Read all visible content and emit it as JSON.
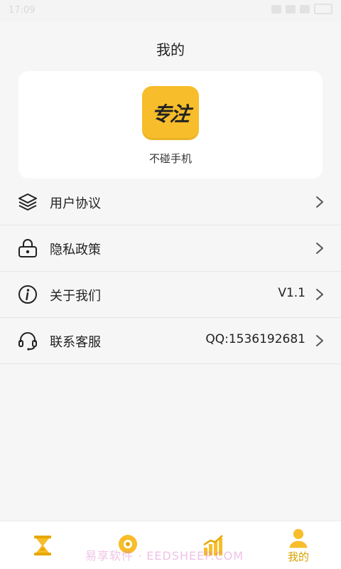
{
  "status_bar": {
    "time": "17:09"
  },
  "page": {
    "title": "我的"
  },
  "profile": {
    "logo_text": "专注",
    "app_name": "不碰手机"
  },
  "menu": [
    {
      "label": "用户协议",
      "value": "",
      "icon": "layers-icon"
    },
    {
      "label": "隐私政策",
      "value": "",
      "icon": "lock-icon"
    },
    {
      "label": "关于我们",
      "value": "V1.1",
      "icon": "info-icon"
    },
    {
      "label": "联系客服",
      "value": "QQ:1536192681",
      "icon": "headset-icon"
    }
  ],
  "tabs": [
    {
      "label": "",
      "icon": "hourglass-icon"
    },
    {
      "label": "",
      "icon": "focus-target-icon"
    },
    {
      "label": "",
      "icon": "chart-icon"
    },
    {
      "label": "我的",
      "icon": "user-icon",
      "active": true
    }
  ],
  "watermark": "易享软件 · EEDSHEEP.COM",
  "colors": {
    "accent": "#f7bd2a",
    "tab_active": "#d8a200",
    "background": "#f6f6f6"
  }
}
